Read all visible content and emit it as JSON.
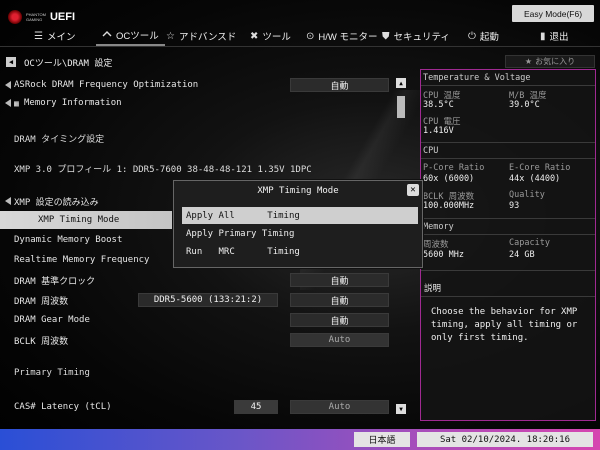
{
  "brand": {
    "line1": "PHANTOM",
    "line2": "GAMING",
    "uefi": "UEFI"
  },
  "easy_mode_label": "Easy Mode(F6)",
  "nav": [
    {
      "icon": "☰",
      "label": "メイン"
    },
    {
      "icon": "",
      "label": "OCツール"
    },
    {
      "icon": "☆",
      "label": "アドバンスド"
    },
    {
      "icon": "✖",
      "label": "ツール"
    },
    {
      "icon": "⊙",
      "label": "H/W モニター"
    },
    {
      "icon": "⛊",
      "label": "セキュリティ"
    },
    {
      "icon": "⏻",
      "label": "起動"
    },
    {
      "icon": "▮",
      "label": "退出"
    }
  ],
  "breadcrumb": "OCツール\\DRAM 設定",
  "favorite_label": "お気に入り",
  "rows": [
    {
      "label": "ASRock DRAM Frequency Optimization",
      "value": "自動"
    },
    {
      "label": "Memory Information"
    },
    {
      "label": "DRAM タイミング設定"
    },
    {
      "label": "XMP 3.0 プロフィール 1: DDR5-7600 38-48-48-121 1.35V 1DPC"
    },
    {
      "label": "XMP 設定の読み込み"
    },
    {
      "label": "XMP Timing Mode"
    },
    {
      "label": "Dynamic Memory Boost"
    },
    {
      "label": "Realtime Memory Frequency"
    },
    {
      "label": "DRAM 基準クロック",
      "value": "自動"
    },
    {
      "label": "DRAM 周波数",
      "mid": "DDR5-5600 (133:21:2)",
      "value": "自動"
    },
    {
      "label": "DRAM Gear Mode",
      "value": "自動"
    },
    {
      "label": "BCLK 周波数",
      "value": "Auto"
    },
    {
      "label": "Primary Timing"
    },
    {
      "label": "CAS# Latency (tCL)",
      "short": "45",
      "value": "Auto"
    }
  ],
  "panel": {
    "title": "Temperature & Voltage",
    "cpu_temp_label": "CPU 温度",
    "cpu_temp": "38.5°C",
    "mb_temp_label": "M/B 温度",
    "mb_temp": "39.0°C",
    "cpu_volt_label": "CPU 電圧",
    "cpu_volt": "1.416V",
    "cpu_section": "CPU",
    "pcore_label": "P-Core Ratio",
    "pcore": "60x (6000)",
    "ecore_label": "E-Core Ratio",
    "ecore": "44x (4400)",
    "bclk_label": "BCLK 周波数",
    "bclk": "100.000MHz",
    "quality_label": "Quality",
    "quality": "93",
    "mem_section": "Memory",
    "freq_label": "周波数",
    "freq": "5600 MHz",
    "cap_label": "Capacity",
    "cap": "24 GB",
    "desc_title": "説明",
    "desc": "Choose the behavior for XMP timing, apply all timing or only first timing."
  },
  "modal": {
    "title": "XMP Timing Mode",
    "options": [
      "Apply All      Timing",
      "Apply Primary Timing",
      "Run   MRC      Timing"
    ]
  },
  "footer": {
    "lang": "日本語",
    "clock": "Sat 02/10/2024. 18:20:16"
  }
}
